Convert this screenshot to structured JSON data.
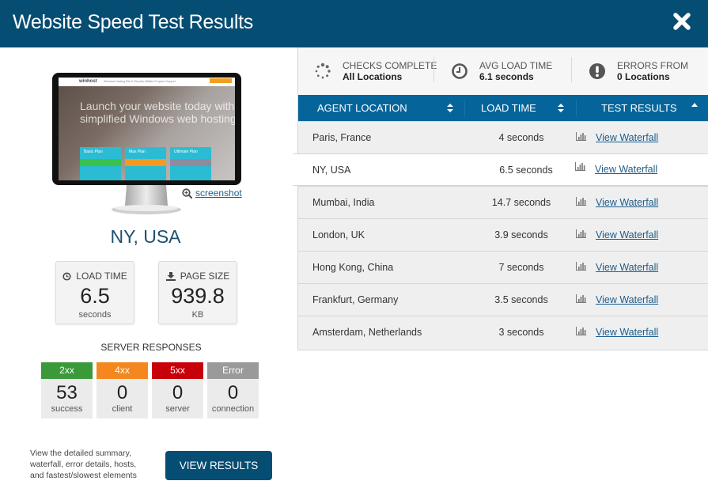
{
  "header": {
    "title": "Website Speed Test Results",
    "close_icon": "close-x-icon"
  },
  "preview": {
    "site_logo": "winhost",
    "site_nav": "Windows Hosting    Site & Security    Affiliate Program    Support",
    "site_headline": "Launch your website today with simplified Windows web hosting",
    "plans": [
      {
        "name": "Basic Plan",
        "color": "#38c24a"
      },
      {
        "name": "Max Plan",
        "color": "#f59a1e"
      },
      {
        "name": "Ultimate Plan",
        "color": "#8f8aa0"
      }
    ],
    "screenshot_link": "screenshot",
    "screenshot_icon": "zoom-in-icon"
  },
  "selected": {
    "location": "NY, USA",
    "load_time": {
      "label": "LOAD TIME",
      "value": "6.5",
      "unit": "seconds",
      "icon": "clock-icon"
    },
    "page_size": {
      "label": "PAGE SIZE",
      "value": "939.8",
      "unit": "KB",
      "icon": "download-icon"
    }
  },
  "server_responses": {
    "title": "SERVER RESPONSES",
    "items": [
      {
        "code": "2xx",
        "count": "53",
        "label": "success",
        "color": "#3a9a3a"
      },
      {
        "code": "4xx",
        "count": "0",
        "label": "client",
        "color": "#f5871f"
      },
      {
        "code": "5xx",
        "count": "0",
        "label": "server",
        "color": "#c8000a"
      },
      {
        "code": "Error",
        "count": "0",
        "label": "connection",
        "color": "#9a9a9a"
      }
    ]
  },
  "footer": {
    "description": "View the detailed summary, waterfall, error details, hosts, and fastest/slowest elements",
    "button_label": "VIEW RESULTS"
  },
  "summary": {
    "checks": {
      "label": "CHECKS COMPLETE",
      "value": "All Locations",
      "icon": "spinner-dots-icon"
    },
    "avg": {
      "label": "AVG LOAD TIME",
      "value": "6.1 seconds",
      "icon": "clock-icon"
    },
    "errors": {
      "label": "ERRORS FROM",
      "value": "0 Locations",
      "icon": "exclamation-circle-icon"
    }
  },
  "table": {
    "columns": [
      "AGENT LOCATION",
      "LOAD TIME",
      "TEST RESULTS"
    ],
    "rows": [
      {
        "location": "Paris, France",
        "load_time": "4 seconds",
        "link": "View Waterfall"
      },
      {
        "location": "NY, USA",
        "load_time": "6.5 seconds",
        "link": "View Waterfall",
        "selected": true
      },
      {
        "location": "Mumbai, India",
        "load_time": "14.7 seconds",
        "link": "View Waterfall"
      },
      {
        "location": "London, UK",
        "load_time": "3.9 seconds",
        "link": "View Waterfall"
      },
      {
        "location": "Hong Kong, China",
        "load_time": "7 seconds",
        "link": "View Waterfall"
      },
      {
        "location": "Frankfurt, Germany",
        "load_time": "3.5 seconds",
        "link": "View Waterfall"
      },
      {
        "location": "Amsterdam, Netherlands",
        "load_time": "3 seconds",
        "link": "View Waterfall"
      }
    ]
  }
}
